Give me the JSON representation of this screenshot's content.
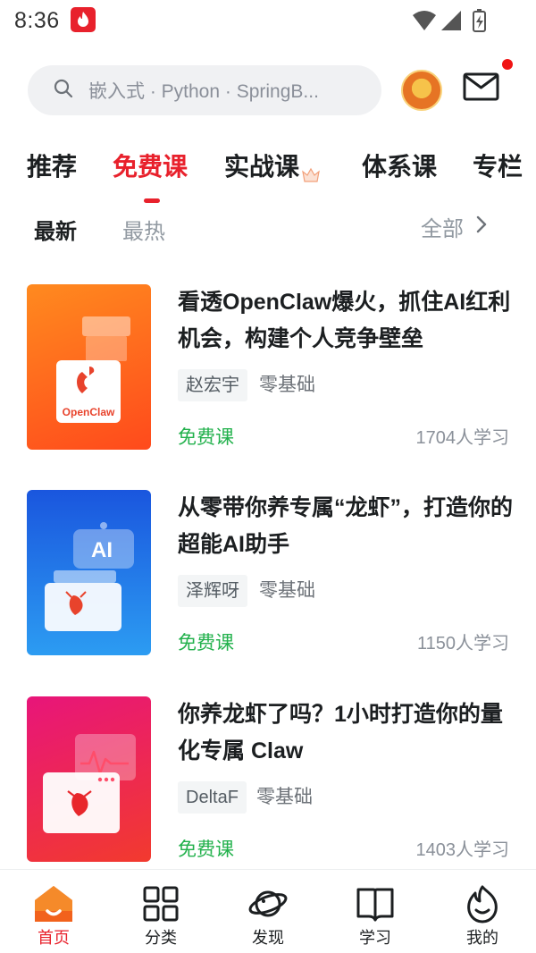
{
  "status_bar": {
    "time": "8:36"
  },
  "search": {
    "placeholder": "嵌入式 · Python · SpringB..."
  },
  "category_tabs": [
    {
      "label": "推荐"
    },
    {
      "label": "免费课"
    },
    {
      "label": "实战课"
    },
    {
      "label": "体系课"
    },
    {
      "label": "专栏"
    }
  ],
  "active_category": "免费课",
  "sub_tabs": [
    {
      "label": "最新"
    },
    {
      "label": "最热"
    }
  ],
  "filter": {
    "label": "全部"
  },
  "courses": [
    {
      "title": "看透OpenClaw爆火，抓住AI红利机会，构建个人竞争壁垒",
      "teacher": "赵宏宇",
      "level": "零基础",
      "price": "免费课",
      "learners": "1704人学习",
      "cover_text": "OpenClaw",
      "cover_colors": [
        "#ff7a1a",
        "#ff4a1c"
      ]
    },
    {
      "title": "从零带你养专属“龙虾”，打造你的超能AI助手",
      "teacher": "泽辉呀",
      "level": "零基础",
      "price": "免费课",
      "learners": "1150人学习",
      "cover_text": "AI",
      "cover_colors": [
        "#1a5fe0",
        "#2b9af3"
      ]
    },
    {
      "title": "你养龙虾了吗？1小时打造你的量化专属 Claw",
      "teacher": "DeltaF",
      "level": "零基础",
      "price": "免费课",
      "learners": "1403人学习",
      "cover_colors": [
        "#e8176b",
        "#f23a2e"
      ]
    }
  ],
  "bottom_nav": [
    {
      "label": "首页",
      "icon": "home-icon"
    },
    {
      "label": "分类",
      "icon": "grid-icon"
    },
    {
      "label": "发现",
      "icon": "planet-icon"
    },
    {
      "label": "学习",
      "icon": "book-icon"
    },
    {
      "label": "我的",
      "icon": "flame-face-icon"
    }
  ],
  "colors": {
    "accent": "#e8212c",
    "free_green": "#22b14c"
  }
}
